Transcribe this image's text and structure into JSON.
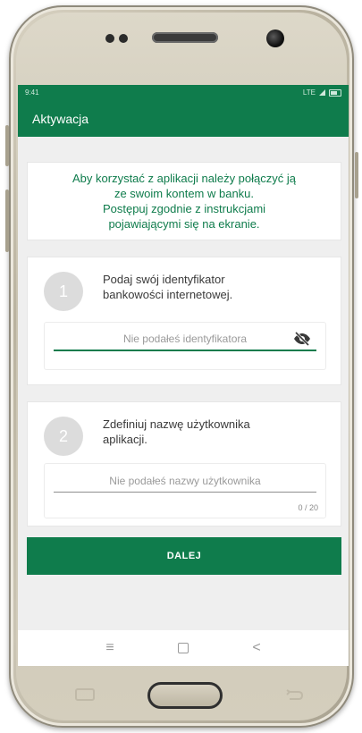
{
  "app": {
    "title": "Aktywacja",
    "accent_color": "#0f7c4c"
  },
  "statusbar": {
    "time": "9:41",
    "network": "LTE"
  },
  "intro": {
    "text": "Aby korzystać z aplikacji należy połączyć ją\nze swoim kontem w banku.\nPostępuj zgodnie z instrukcjami\npojawiającymi się na ekranie."
  },
  "step1": {
    "number": "1",
    "title": "Podaj swój identyfikator\nbankowości internetowej.",
    "placeholder": "Nie podałeś identyfikatora",
    "toggle_icon": "eye-slash-icon"
  },
  "step2": {
    "number": "2",
    "title": "Zdefiniuj nazwę użytkownika\naplikacji.",
    "placeholder": "Nie podałeś nazwy użytkownika",
    "counter": "0 / 20"
  },
  "actions": {
    "next_label": "DALEJ"
  },
  "navbar": {
    "recent_icon": "≡",
    "home_icon": "square-icon",
    "back_icon": "<"
  }
}
